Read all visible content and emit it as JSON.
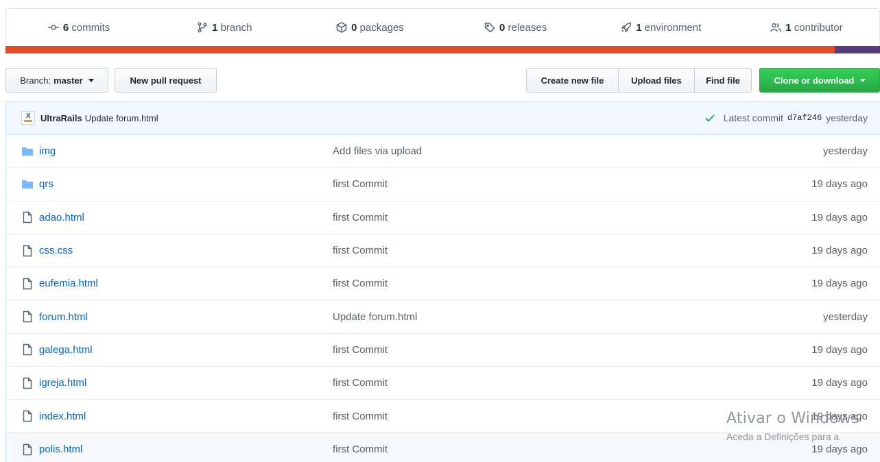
{
  "summary": {
    "stats": [
      {
        "count": "6",
        "label": "commits",
        "icon": "commit-icon"
      },
      {
        "count": "1",
        "label": "branch",
        "icon": "branch-icon"
      },
      {
        "count": "0",
        "label": "packages",
        "icon": "package-icon"
      },
      {
        "count": "0",
        "label": "releases",
        "icon": "tag-icon"
      },
      {
        "count": "1",
        "label": "environment",
        "icon": "rocket-icon"
      },
      {
        "count": "1",
        "label": "contributor",
        "icon": "people-icon"
      }
    ],
    "language_colors": [
      "#e34c26",
      "#563d7c"
    ],
    "language_shares": [
      0.948,
      0.052
    ]
  },
  "toolbar": {
    "branch_prefix": "Branch:",
    "branch_name": "master",
    "new_pull_request": "New pull request",
    "create_new_file": "Create new file",
    "upload_files": "Upload files",
    "find_file": "Find file",
    "clone_or_download": "Clone or download"
  },
  "latest_commit": {
    "author": "UltraRails",
    "message": "Update forum.html",
    "prefix": "Latest commit",
    "sha": "d7af246",
    "time": "yesterday"
  },
  "files": [
    {
      "type": "dir",
      "name": "img",
      "message": "Add files via upload",
      "age": "yesterday"
    },
    {
      "type": "dir",
      "name": "qrs",
      "message": "first Commit",
      "age": "19 days ago"
    },
    {
      "type": "file",
      "name": "adao.html",
      "message": "first Commit",
      "age": "19 days ago"
    },
    {
      "type": "file",
      "name": "css.css",
      "message": "first Commit",
      "age": "19 days ago"
    },
    {
      "type": "file",
      "name": "eufemia.html",
      "message": "first Commit",
      "age": "19 days ago"
    },
    {
      "type": "file",
      "name": "forum.html",
      "message": "Update forum.html",
      "age": "yesterday"
    },
    {
      "type": "file",
      "name": "galega.html",
      "message": "first Commit",
      "age": "19 days ago"
    },
    {
      "type": "file",
      "name": "igreja.html",
      "message": "first Commit",
      "age": "19 days ago"
    },
    {
      "type": "file",
      "name": "index.html",
      "message": "first Commit",
      "age": "19 days ago"
    },
    {
      "type": "file",
      "name": "polis.html",
      "message": "first Commit",
      "age": "19 days ago"
    }
  ],
  "watermark": {
    "line1": "Ativar o Windows",
    "line2": "Aceda a Definições para a"
  }
}
